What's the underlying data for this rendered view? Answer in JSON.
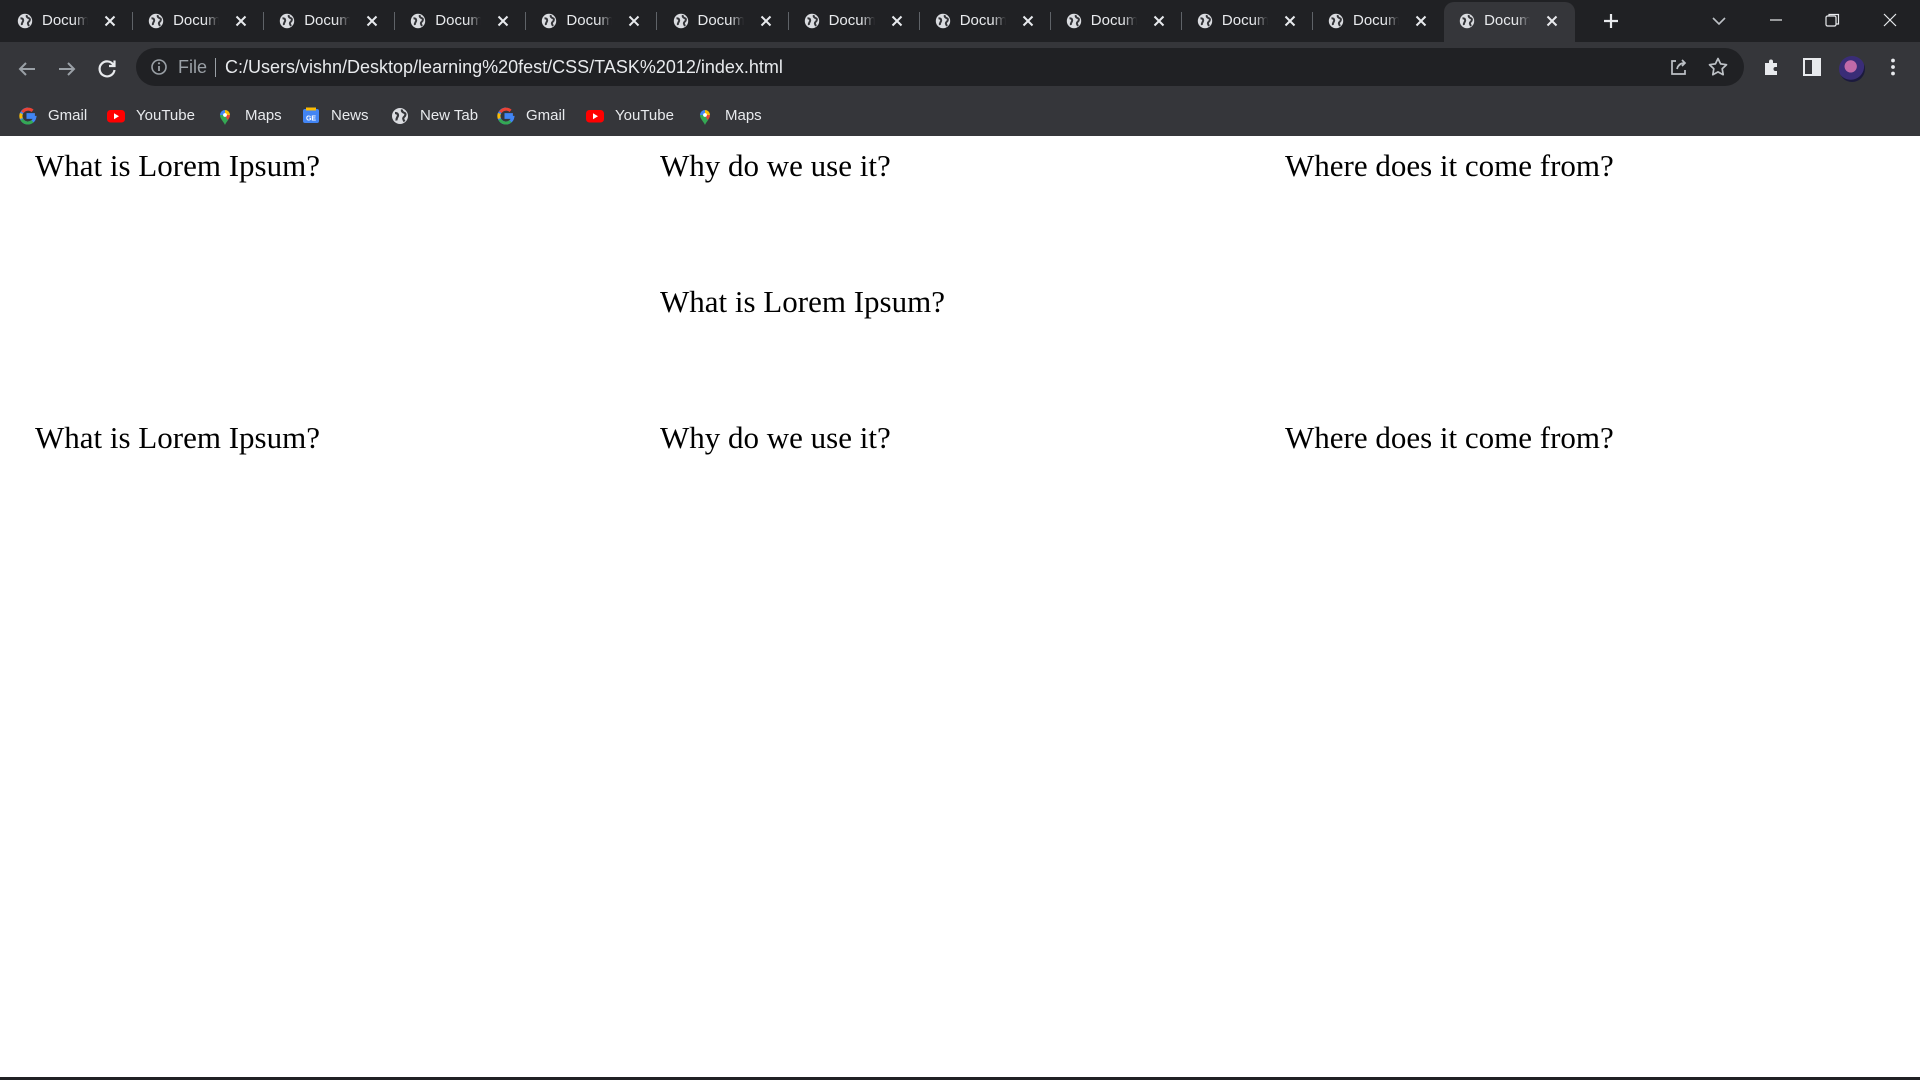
{
  "browser": {
    "tabs": [
      {
        "title": "Docum"
      },
      {
        "title": "Docum"
      },
      {
        "title": "Docum"
      },
      {
        "title": "Docum"
      },
      {
        "title": "Docum"
      },
      {
        "title": "Docum"
      },
      {
        "title": "Docum"
      },
      {
        "title": "Docum"
      },
      {
        "title": "Docum"
      },
      {
        "title": "Docum"
      },
      {
        "title": "Docum"
      },
      {
        "title": "Docum",
        "active": true
      }
    ],
    "address_bar": {
      "scheme_label": "File",
      "url": "C:/Users/vishn/Desktop/learning%20fest/CSS/TASK%2012/index.html"
    },
    "bookmarks": [
      {
        "label": "Gmail",
        "icon": "google-icon"
      },
      {
        "label": "YouTube",
        "icon": "youtube-icon"
      },
      {
        "label": "Maps",
        "icon": "maps-icon"
      },
      {
        "label": "News",
        "icon": "news-icon"
      },
      {
        "label": "New Tab",
        "icon": "globe-icon"
      },
      {
        "label": "Gmail",
        "icon": "google-icon"
      },
      {
        "label": "YouTube",
        "icon": "youtube-icon"
      },
      {
        "label": "Maps",
        "icon": "maps-icon"
      }
    ]
  },
  "page": {
    "rows": [
      [
        "What is Lorem Ipsum?",
        "Why do we use it?",
        "Where does it come from?"
      ],
      [
        "What is Lorem Ipsum?"
      ],
      [
        "What is Lorem Ipsum?",
        "Why do we use it?",
        "Where does it come from?"
      ]
    ]
  }
}
